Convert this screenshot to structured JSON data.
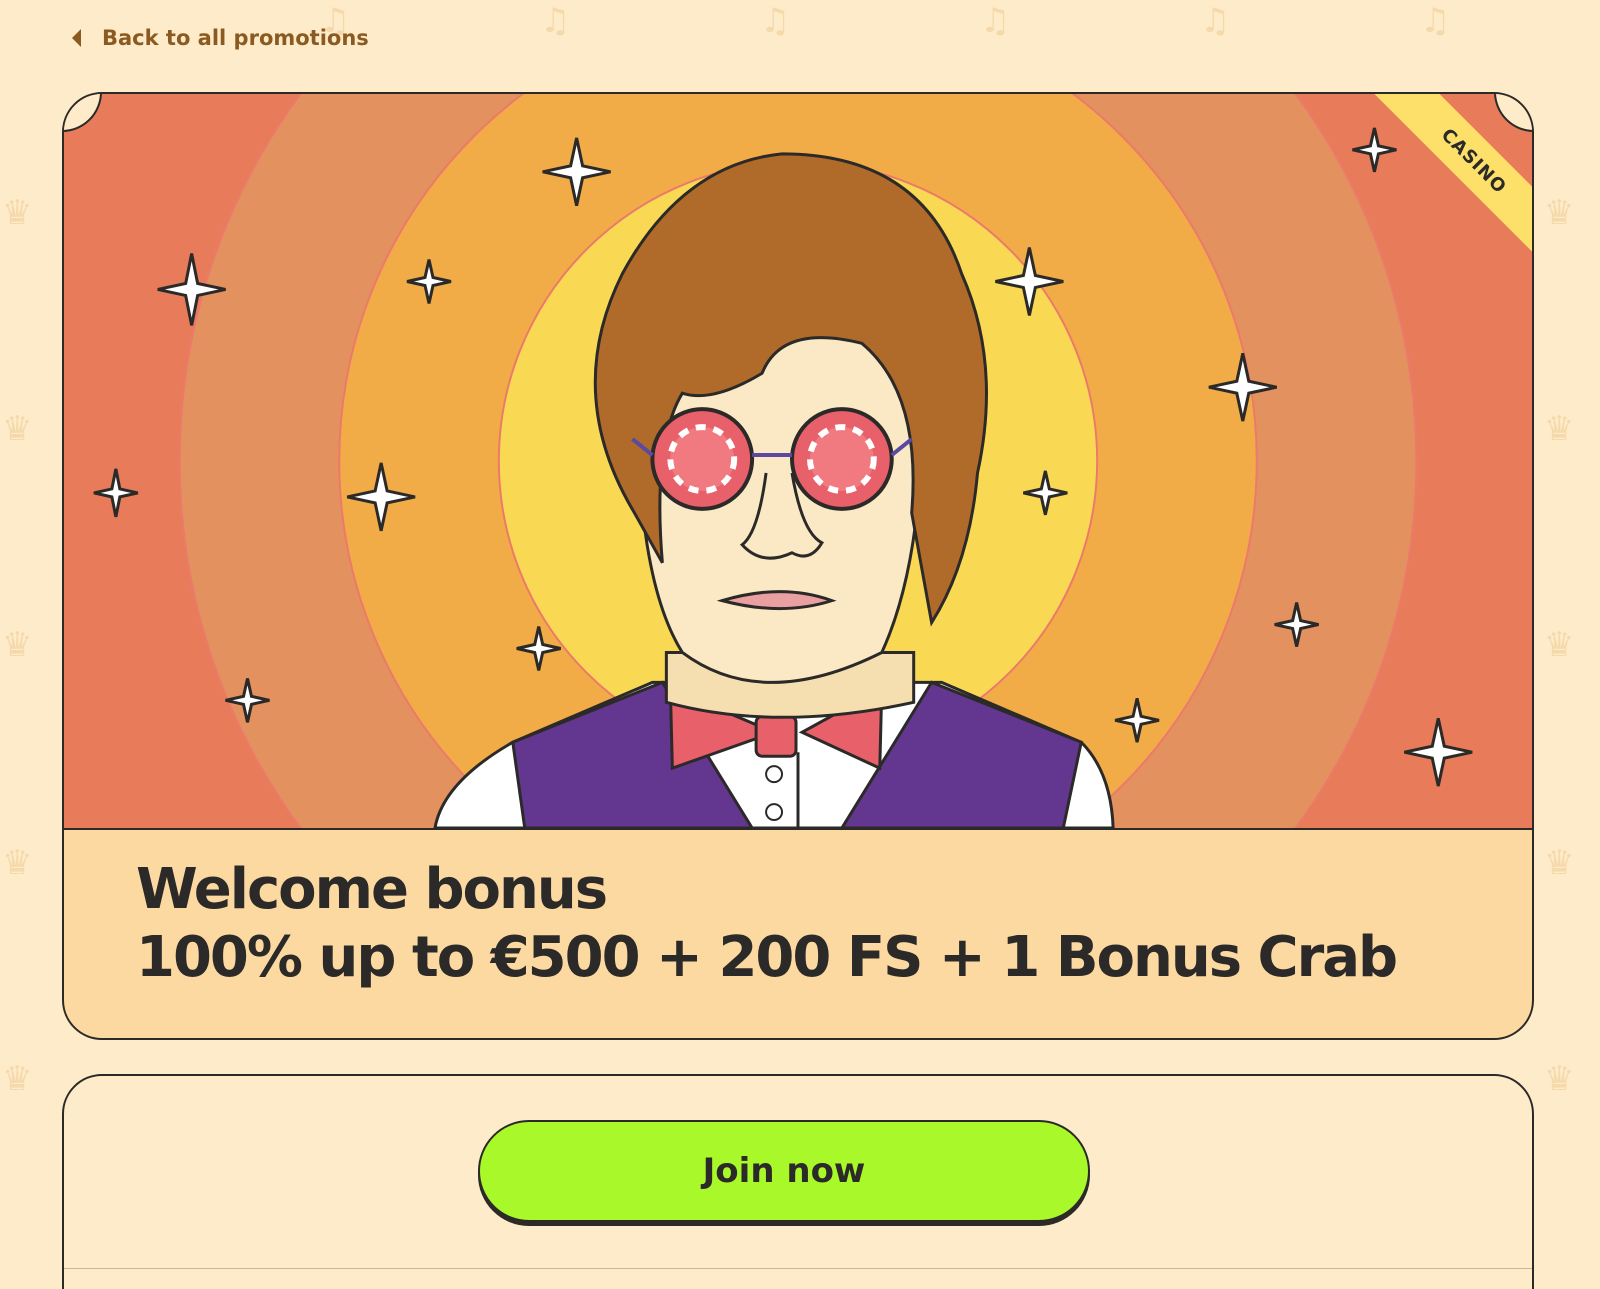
{
  "nav": {
    "back_label": "Back to all promotions",
    "back_icon": "chevron-left-icon"
  },
  "promo": {
    "category_ribbon": "CASINO",
    "title_line1": "Welcome bonus",
    "title_line2": "100% up to €500 + 200 FS + 1 Bonus Crab",
    "illustration": "hero-illustration-musician-with-chip-glasses"
  },
  "action": {
    "join_label": "Join now"
  },
  "colors": {
    "page_bg": "#fdebca",
    "card_bg": "#fdd9a2",
    "ribbon": "#fde06a",
    "cta": "#a8f82a",
    "text_dark": "#2b2a28",
    "link_brown": "#8a5a21",
    "ring_outer": "#e77b5a",
    "ring_2": "#e3915f",
    "ring_3": "#f2ac47",
    "ring_inner": "#f9d854",
    "vest": "#63368f",
    "bowtie": "#e8606a"
  }
}
